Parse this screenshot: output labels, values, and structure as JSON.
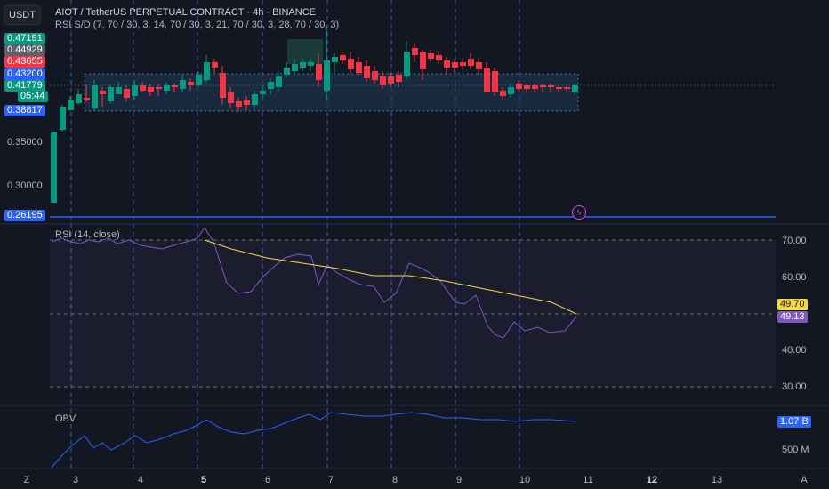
{
  "symbol_pill": "USDT",
  "header": {
    "title": "AIOT / TetherUS PERPETUAL CONTRACT · 4h · BINANCE",
    "indicator": "RSI S/D (7, 70 / 30, 3, 14, 70 / 30, 3, 21, 70 / 30, 3, 28, 70 / 30, 3)"
  },
  "price_labels": [
    {
      "text": "0.47191",
      "bg": "#089981",
      "fg": "#ffffff"
    },
    {
      "text": "0.44929",
      "bg": "#5d606b",
      "fg": "#ffffff"
    },
    {
      "text": "0.43655",
      "bg": "#f23645",
      "fg": "#ffffff"
    },
    {
      "text": "0.43200",
      "bg": "#2962ff",
      "fg": "#ffffff"
    },
    {
      "text": "0.41779",
      "bg": "#089981",
      "fg": "#ffffff"
    },
    {
      "text": "05:44",
      "bg": "#089981",
      "fg": "#ffffff"
    },
    {
      "text": "0.38817",
      "bg": "#2962ff",
      "fg": "#ffffff"
    },
    {
      "text": "0.26195",
      "bg": "#2962ff",
      "fg": "#ffffff"
    }
  ],
  "price_axis": [
    "0.35000",
    "0.30000"
  ],
  "rsi": {
    "title": "RSI (14, close)",
    "axis": [
      "70.00",
      "60.00",
      "40.00",
      "30.00"
    ],
    "value_label": "49.70",
    "value_label_bg": "#f5d742",
    "value_label_2": "49.13",
    "value_label_2_bg": "#7e57c2"
  },
  "obv": {
    "title": "OBV",
    "value_label": "1.07 B",
    "value_label_bg": "#2962ff",
    "axis": [
      "500 M"
    ]
  },
  "x_axis": [
    "3",
    "4",
    "5",
    "6",
    "7",
    "8",
    "9",
    "10",
    "11",
    "12",
    "13"
  ],
  "x_axis_bold": [
    "5",
    "12"
  ],
  "corner_left": "Z",
  "corner_right": "A",
  "colors": {
    "up": "#089981",
    "down": "#f23645",
    "rsi_line": "#7e57c2",
    "rsi_ma": "#f5d742",
    "obv_line": "#2962ff",
    "zone": "#1f3a55"
  }
}
